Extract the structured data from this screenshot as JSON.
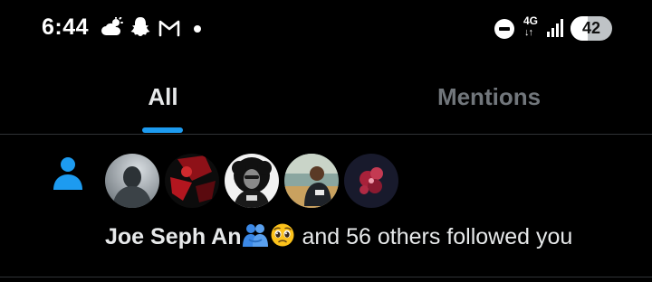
{
  "status_bar": {
    "time": "6:44",
    "network": "4G",
    "network_arrows": "↓↑",
    "battery_level": "42",
    "battery_fraction": 0.42,
    "icons": [
      "weather-cloud-icon",
      "snapchat-icon",
      "gmail-icon",
      "notification-dot-icon",
      "do-not-disturb-icon",
      "signal-icon",
      "battery-icon"
    ]
  },
  "tabs": [
    {
      "label": "All",
      "selected": true
    },
    {
      "label": "Mentions",
      "selected": false
    }
  ],
  "notification": {
    "icon": "person-follow-icon",
    "actor_name": "Joe Seph An",
    "name_emojis": [
      "people-hugging-emoji",
      "pleading-face-emoji"
    ],
    "action_text": "and 56 others followed you",
    "avatar_count": 5
  },
  "colors": {
    "background": "#000000",
    "accent": "#1d9bf0",
    "primary_text": "#e7e9ea",
    "secondary_text": "#71767b",
    "divider": "#2f3336"
  }
}
